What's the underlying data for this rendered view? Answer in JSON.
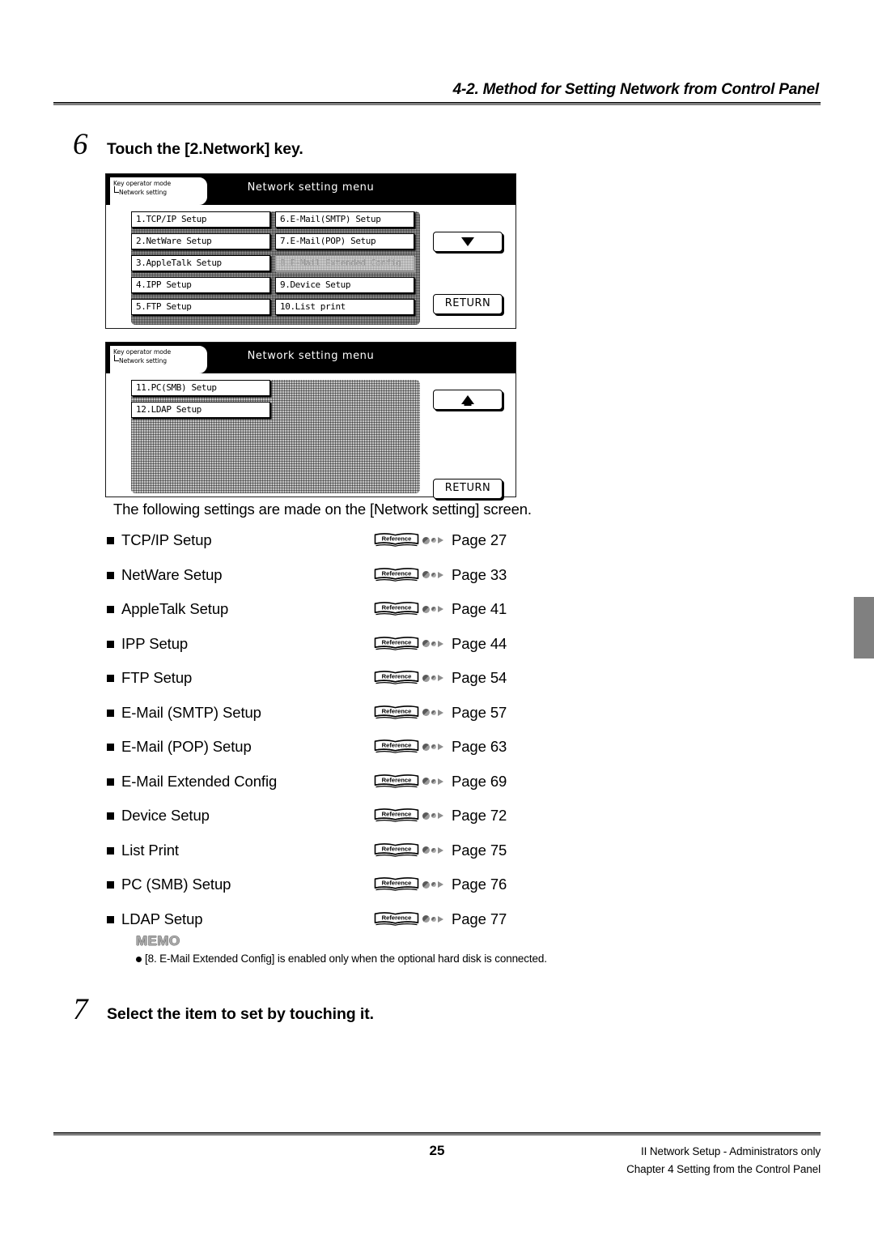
{
  "header": {
    "running_head": "4-2. Method for Setting Network from Control Panel"
  },
  "steps": [
    {
      "number": "6",
      "text": "Touch the [2.Network] key."
    },
    {
      "number": "7",
      "text": "Select the item to set by touching it."
    }
  ],
  "panels": [
    {
      "breadcrumb_line1": "Key operator mode",
      "breadcrumb_line2": "Network setting",
      "title": "Network setting menu",
      "keys_left": [
        {
          "label": "1.TCP/IP Setup",
          "disabled": false
        },
        {
          "label": "2.NetWare Setup",
          "disabled": false
        },
        {
          "label": "3.AppleTalk Setup",
          "disabled": false
        },
        {
          "label": "4.IPP Setup",
          "disabled": false
        },
        {
          "label": "5.FTP Setup",
          "disabled": false
        }
      ],
      "keys_right": [
        {
          "label": "6.E-Mail(SMTP) Setup",
          "disabled": false
        },
        {
          "label": "7.E-Mail(POP) Setup",
          "disabled": false
        },
        {
          "label": "8.E-Mail Extended Config",
          "disabled": true
        },
        {
          "label": "9.Device Setup",
          "disabled": false
        },
        {
          "label": "10.List print",
          "disabled": false
        }
      ],
      "scroll_button": "down-arrow",
      "return_label": "RETURN"
    },
    {
      "breadcrumb_line1": "Key operator mode",
      "breadcrumb_line2": "Network setting",
      "title": "Network setting menu",
      "keys_left": [
        {
          "label": "11.PC(SMB) Setup",
          "disabled": false
        },
        {
          "label": "12.LDAP Setup",
          "disabled": false
        }
      ],
      "keys_right": [],
      "scroll_button": "up-arrow",
      "return_label": "RETURN"
    }
  ],
  "intro": "The following settings are made on the [Network setting] screen.",
  "reference_icon_label": "Reference",
  "reference_list": [
    {
      "label": "TCP/IP Setup",
      "page": "Page 27"
    },
    {
      "label": "NetWare Setup",
      "page": "Page 33"
    },
    {
      "label": "AppleTalk Setup",
      "page": "Page 41"
    },
    {
      "label": "IPP Setup",
      "page": "Page 44"
    },
    {
      "label": "FTP Setup",
      "page": "Page 54"
    },
    {
      "label": "E-Mail (SMTP) Setup",
      "page": "Page 57"
    },
    {
      "label": "E-Mail (POP) Setup",
      "page": "Page 63"
    },
    {
      "label": "E-Mail Extended Config",
      "page": "Page 69"
    },
    {
      "label": "Device Setup",
      "page": "Page 72"
    },
    {
      "label": "List Print",
      "page": "Page 75"
    },
    {
      "label": "PC (SMB) Setup",
      "page": "Page 76"
    },
    {
      "label": "LDAP Setup",
      "page": "Page 77"
    }
  ],
  "memo": {
    "title": "MEMO",
    "items": [
      "[8. E-Mail Extended Config] is enabled only when the optional hard disk is connected."
    ]
  },
  "footer": {
    "page_number": "25",
    "line1": "II Network Setup - Administrators only",
    "line2": "Chapter 4 Setting from the Control Panel"
  },
  "colors": {
    "rule": "#808080",
    "thumb_tab": "#808080",
    "memo_title": "#a9a9a9"
  }
}
